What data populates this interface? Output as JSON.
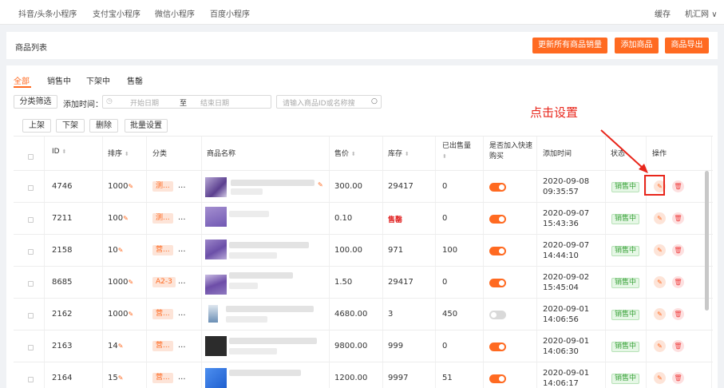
{
  "topnav": {
    "items": [
      "抖音/头条小程序",
      "支付宝小程序",
      "微信小程序",
      "百度小程序"
    ],
    "cache": "缓存",
    "user": "机汇网"
  },
  "header": {
    "title": "商品列表",
    "btn_update": "更新所有商品销量",
    "btn_add": "添加商品",
    "btn_export": "商品导出"
  },
  "tabs": [
    "全部",
    "销售中",
    "下架中",
    "售罄"
  ],
  "filters": {
    "category_btn": "分类筛选",
    "time_label": "添加时间：",
    "start_placeholder": "开始日期",
    "to": "至",
    "end_placeholder": "结束日期",
    "search_placeholder": "请输入商品ID或名称搜"
  },
  "actions": {
    "up": "上架",
    "down": "下架",
    "delete": "删除",
    "batch": "批量设置"
  },
  "columns": {
    "id": "ID",
    "sort": "排序",
    "category": "分类",
    "name": "商品名称",
    "price": "售价",
    "stock": "库存",
    "sold": "已出售量",
    "quick": "是否加入快速购买",
    "time": "添加时间",
    "status": "状态",
    "ops": "操作"
  },
  "rows": [
    {
      "id": "4746",
      "sort": "1000",
      "cat": "测...",
      "price": "300.00",
      "stock": "29417",
      "sold": "0",
      "quick": true,
      "time": "2020-09-08 09:35:57",
      "status": "销售中"
    },
    {
      "id": "7211",
      "sort": "100",
      "cat": "测...",
      "price": "0.10",
      "stock": "售罄",
      "sold": "0",
      "quick": true,
      "time": "2020-09-07 15:43:36",
      "status": "销售中"
    },
    {
      "id": "2158",
      "sort": "10",
      "cat": "营...",
      "price": "100.00",
      "stock": "971",
      "sold": "100",
      "quick": true,
      "time": "2020-09-07 14:44:10",
      "status": "销售中"
    },
    {
      "id": "8685",
      "sort": "1000",
      "cat": "A2-3",
      "price": "1.50",
      "stock": "29417",
      "sold": "0",
      "quick": true,
      "time": "2020-09-02 15:45:04",
      "status": "销售中"
    },
    {
      "id": "2162",
      "sort": "1000",
      "cat": "营...",
      "price": "4680.00",
      "stock": "3",
      "sold": "450",
      "quick": false,
      "time": "2020-09-01 14:06:56",
      "status": "销售中"
    },
    {
      "id": "2163",
      "sort": "14",
      "cat": "营...",
      "price": "9800.00",
      "stock": "999",
      "sold": "0",
      "quick": true,
      "time": "2020-09-01 14:06:30",
      "status": "销售中"
    },
    {
      "id": "2164",
      "sort": "15",
      "cat": "营...",
      "price": "1200.00",
      "stock": "9997",
      "sold": "51",
      "quick": true,
      "time": "2020-09-01 14:06:17",
      "status": "销售中"
    }
  ],
  "annotation": "点击设置",
  "colors": {
    "accent": "#ff6a21",
    "annotation": "#e8261b",
    "status_green": "#3aa23a"
  }
}
